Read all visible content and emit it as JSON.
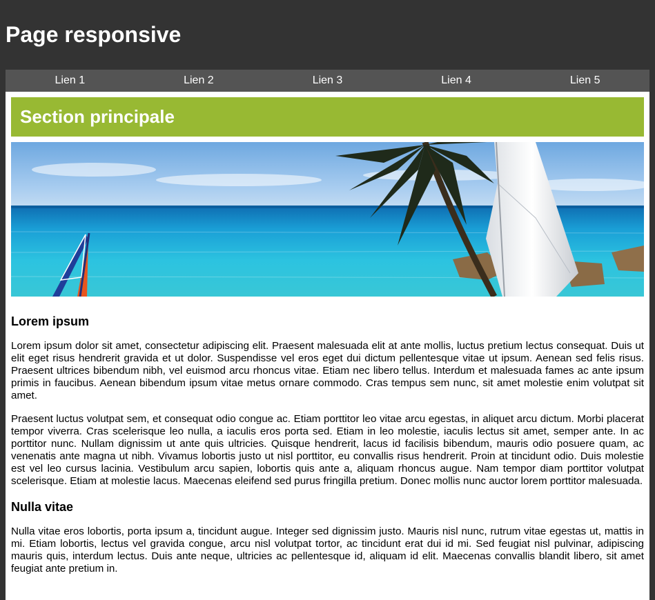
{
  "header": {
    "title": "Page responsive"
  },
  "nav": {
    "links": [
      "Lien 1",
      "Lien 2",
      "Lien 3",
      "Lien 4",
      "Lien 5"
    ]
  },
  "main": {
    "section_title": "Section principale",
    "articles": [
      {
        "heading": "Lorem ipsum",
        "paragraphs": [
          "Lorem ipsum dolor sit amet, consectetur adipiscing elit. Praesent malesuada elit at ante mollis, luctus pretium lectus consequat. Duis ut elit eget risus hendrerit gravida et ut dolor. Suspendisse vel eros eget dui dictum pellentesque vitae ut ipsum. Aenean sed felis risus. Praesent ultrices bibendum nibh, vel euismod arcu rhoncus vitae. Etiam nec libero tellus. Interdum et malesuada fames ac ante ipsum primis in faucibus. Aenean bibendum ipsum vitae metus ornare commodo. Cras tempus sem nunc, sit amet molestie enim volutpat sit amet.",
          "Praesent luctus volutpat sem, et consequat odio congue ac. Etiam porttitor leo vitae arcu egestas, in aliquet arcu dictum. Morbi placerat tempor viverra. Cras scelerisque leo nulla, a iaculis eros porta sed. Etiam in leo molestie, iaculis lectus sit amet, semper ante. In ac porttitor nunc. Nullam dignissim ut ante quis ultricies. Quisque hendrerit, lacus id facilisis bibendum, mauris odio posuere quam, ac venenatis ante magna ut nibh. Vivamus lobortis justo ut nisl porttitor, eu convallis risus hendrerit. Proin at tincidunt odio. Duis molestie est vel leo cursus lacinia. Vestibulum arcu sapien, lobortis quis ante a, aliquam rhoncus augue. Nam tempor diam porttitor volutpat scelerisque. Etiam at molestie lacus. Maecenas eleifend sed purus fringilla pretium. Donec mollis nunc auctor lorem porttitor malesuada."
        ]
      },
      {
        "heading": "Nulla vitae",
        "paragraphs": [
          "Nulla vitae eros lobortis, porta ipsum a, tincidunt augue. Integer sed dignissim justo. Mauris nisl nunc, rutrum vitae egestas ut, mattis in mi. Etiam lobortis, lectus vel gravida congue, arcu nisl volutpat tortor, ac tincidunt erat dui id mi. Sed feugiat nisl pulvinar, adipiscing mauris quis, interdum lectus. Duis ante neque, ultricies ac pellentesque id, aliquam id elit. Maecenas convallis blandit libero, sit amet feugiat ante pretium in."
        ]
      }
    ]
  },
  "colors": {
    "page_background": "#333333",
    "nav_background": "#545454",
    "banner_green": "#98b933",
    "content_background": "#ffffff"
  }
}
